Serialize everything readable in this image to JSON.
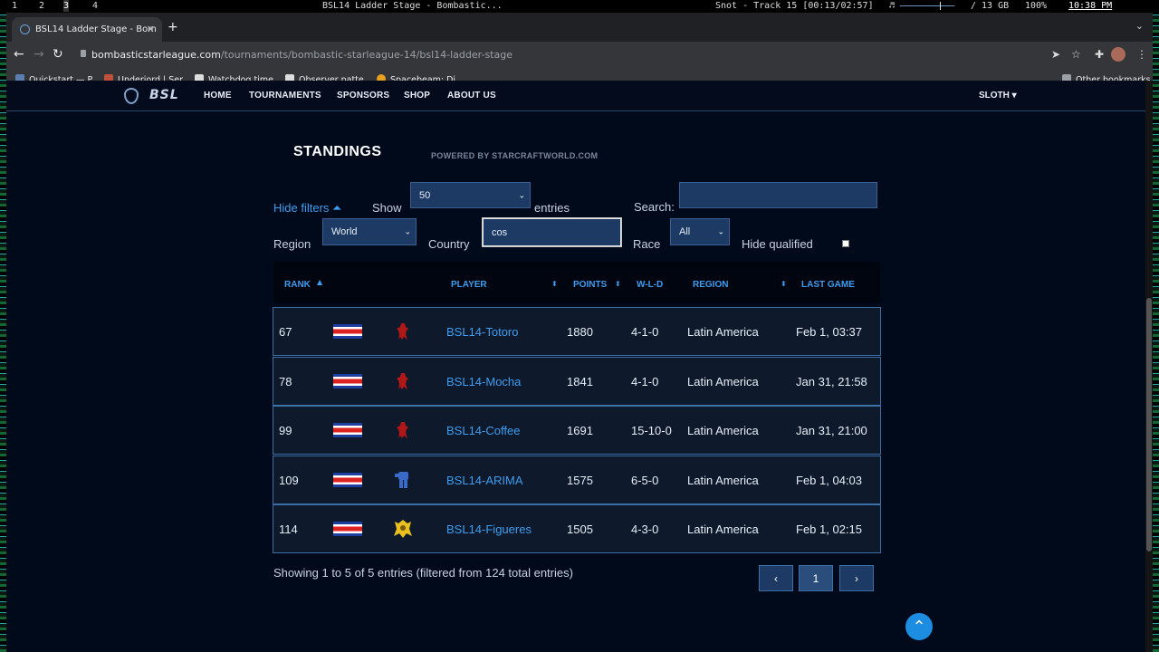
{
  "wm": {
    "workspaces": [
      "1",
      "2",
      "3",
      "4"
    ],
    "window_title": "BSL14 Ladder Stage - Bombastic...",
    "now_playing": "Snot - Track 15 [00:13/02:57]",
    "music_icon": "♬",
    "memory": "/ 13 GB",
    "battery": "100%",
    "clock": "10:38 PM"
  },
  "browser": {
    "tab_title": "BSL14 Ladder Stage - Bom",
    "new_tab": "+",
    "url_host": "bombasticstarleague.com",
    "url_path": "/tournaments/bombastic-starleague-14/bsl14-ladder-stage",
    "bookmarks": [
      {
        "label": "Quickstart — P...",
        "color": "#5a7fb0"
      },
      {
        "label": "Underjord | Ser...",
        "color": "#c0503a"
      },
      {
        "label": "Watchdog time...",
        "color": "#dddddd"
      },
      {
        "label": "Observer patte...",
        "color": "#dddddd"
      },
      {
        "label": "Spacebeam: Di...",
        "color": "#e8a020"
      }
    ],
    "other_bookmarks": "Other bookmarks"
  },
  "site": {
    "logo_text": "BSL",
    "nav": [
      "HOME",
      "TOURNAMENTS",
      "SPONSORS",
      "SHOP",
      "ABOUT US"
    ],
    "user": "SLOTH ▾"
  },
  "standings": {
    "title": "STANDINGS",
    "powered_by": "POWERED BY STARCRAFTWORLD.COM",
    "hide_filters": "Hide filters ⏶",
    "show_label": "Show",
    "show_value": "50",
    "entries_label": "entries",
    "search_label": "Search:",
    "search_value": "",
    "region_label": "Region",
    "region_value": "World",
    "country_label": "Country",
    "country_value": "cos",
    "race_label": "Race",
    "race_value": "All",
    "hide_qualified_label": "Hide qualified",
    "hide_qualified_checked": false
  },
  "table": {
    "columns": [
      "RANK",
      "PLAYER",
      "POINTS",
      "W-L-D",
      "REGION",
      "LAST GAME"
    ],
    "rows": [
      {
        "rank": "67",
        "race": "zerg",
        "player": "BSL14-Totoro",
        "points": "1880",
        "wld": "4-1-0",
        "region": "Latin America",
        "last_game": "Feb 1, 03:37"
      },
      {
        "rank": "78",
        "race": "zerg",
        "player": "BSL14-Mocha",
        "points": "1841",
        "wld": "4-1-0",
        "region": "Latin America",
        "last_game": "Jan 31, 21:58"
      },
      {
        "rank": "99",
        "race": "zerg",
        "player": "BSL14-Coffee",
        "points": "1691",
        "wld": "15-10-0",
        "region": "Latin America",
        "last_game": "Jan 31, 21:00"
      },
      {
        "rank": "109",
        "race": "terran",
        "player": "BSL14-ARIMA",
        "points": "1575",
        "wld": "6-5-0",
        "region": "Latin America",
        "last_game": "Feb 1, 04:03"
      },
      {
        "rank": "114",
        "race": "protoss",
        "player": "BSL14-Figueres",
        "points": "1505",
        "wld": "4-3-0",
        "region": "Latin America",
        "last_game": "Feb 1, 02:15"
      }
    ],
    "info": "Showing 1 to 5 of 5 entries (filtered from 124 total entries)",
    "prev": "‹",
    "page": "1",
    "next": "›"
  },
  "colors": {
    "accent": "#3e9df0",
    "zerg": "#b01818",
    "terran": "#3a6ac8",
    "protoss": "#e8c020"
  }
}
